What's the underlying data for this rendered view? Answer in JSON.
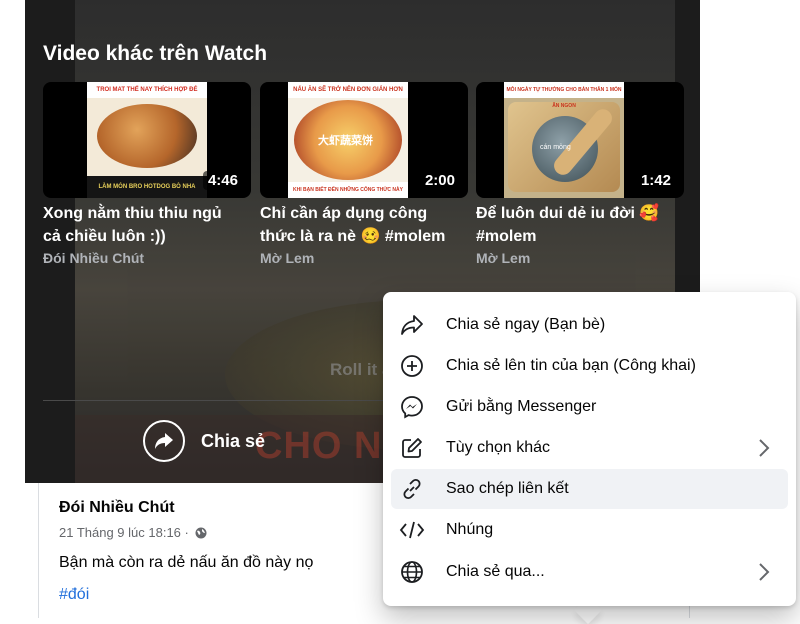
{
  "watch": {
    "section_title": "Video khác trên Watch",
    "videos": [
      {
        "title_line1": "Xong nằm thiu thiu ngủ",
        "title_line2": "cả chiều luôn :))",
        "channel": "Đói Nhiều Chút",
        "duration": "4:46",
        "thumb_banner": "TROI MAT THẾ NAY THÍCH HỢP ĐÉ",
        "thumb_footer": "LÀM MÓN BRO HOTDOG BÒ NHA"
      },
      {
        "title_line1": "Chỉ cần áp dụng công",
        "title_line2": "thức là ra nè 🥴 #molem",
        "channel": "Mờ Lem",
        "duration": "2:00",
        "thumb_banner": "NẤU ĂN SẼ TRỞ NÊN ĐƠN GIẢN HƠN",
        "thumb_text": "大虾蔬菜饼",
        "thumb_footer": "KHI BẠN BIẾT ĐẾN NHỮNG CÔNG THỨC NÀY"
      },
      {
        "title_line1": "Để luôn dui dẻ iu đời 🥰",
        "title_line2": "#molem",
        "channel": "Mờ Lem",
        "duration": "1:42",
        "thumb_banner": "MỖI NGÀY TỰ THƯỞNG CHO BẢN THÂN 1 MÓN ĂN NGON",
        "thumb_text": "cán mỏng"
      }
    ]
  },
  "player": {
    "share_label": "Chia sẻ",
    "bg_caption": "Roll it after",
    "bg_bigtext": "CHO NHỮNG NG"
  },
  "post": {
    "author": "Đói Nhiều Chút",
    "time": "21 Tháng 9 lúc 18:16 ·",
    "text": "Bận mà còn ra dẻ nấu ăn đồ này nọ",
    "hashtag": "#đói"
  },
  "share_menu": {
    "items": [
      {
        "label": "Chia sẻ ngay (Bạn bè)",
        "icon": "share-arrow-icon"
      },
      {
        "label": "Chia sẻ lên tin của bạn (Công khai)",
        "icon": "plus-circle-icon"
      },
      {
        "label": "Gửi bằng Messenger",
        "icon": "messenger-icon"
      },
      {
        "label": "Tùy chọn khác",
        "icon": "edit-icon"
      },
      {
        "label": "Sao chép liên kết",
        "icon": "link-icon"
      },
      {
        "label": "Nhúng",
        "icon": "code-icon"
      },
      {
        "label": "Chia sẻ qua...",
        "icon": "globe-icon"
      }
    ]
  },
  "colors": {
    "accent": "#216fdb",
    "player_bg": "#1c1c1c",
    "menu_hover": "#f0f2f5"
  }
}
